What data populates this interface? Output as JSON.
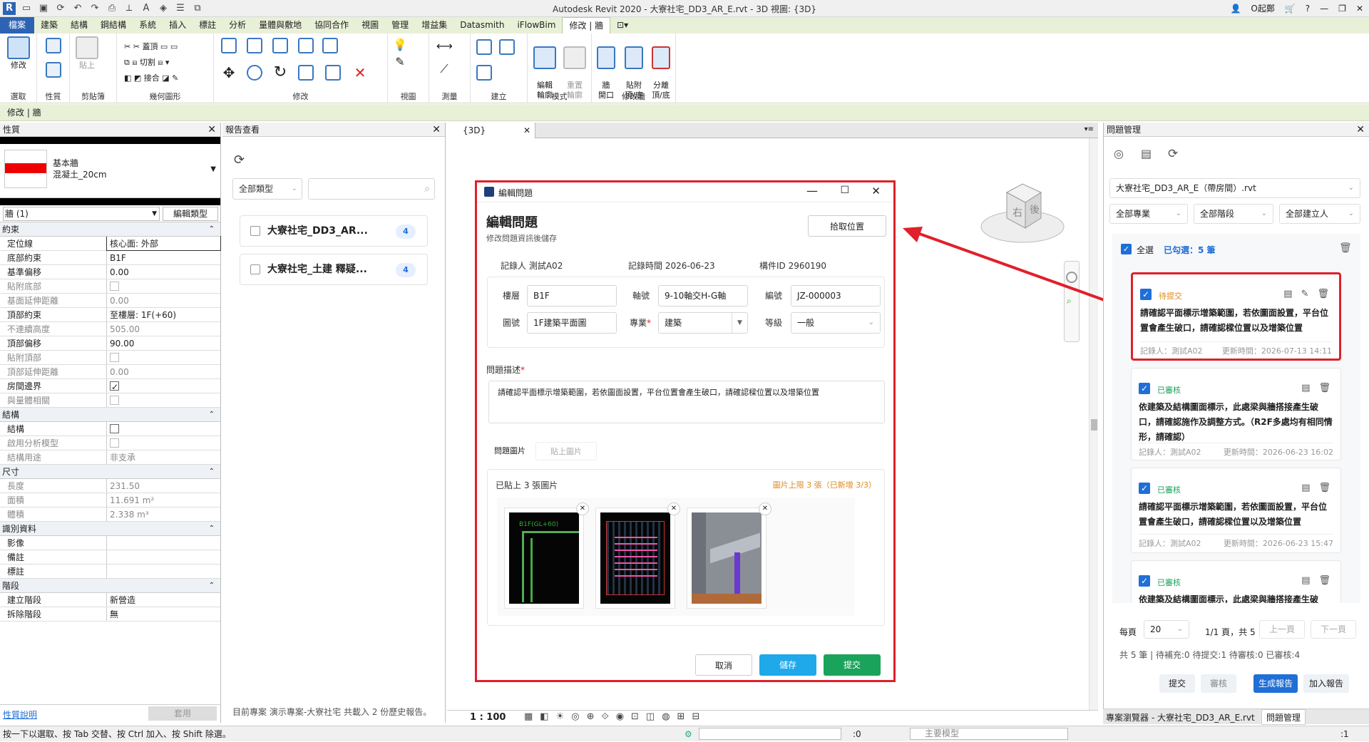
{
  "window": {
    "title": "Autodesk Revit 2020 - 大寮社宅_DD3_AR_E.rvt - 3D 視圖: {3D}",
    "user": "O起鄭"
  },
  "ribbon_tabs": [
    "檔案",
    "建築",
    "結構",
    "鋼結構",
    "系統",
    "插入",
    "標註",
    "分析",
    "量體與敷地",
    "協同合作",
    "視圖",
    "管理",
    "增益集",
    "Datasmith",
    "iFlowBim",
    "修改 | 牆"
  ],
  "ribbon_groups": {
    "select": "選取",
    "props": "性質",
    "clipboard": "剪貼簿",
    "geometry": "幾何圖形",
    "modify": "修改",
    "view": "視圖",
    "measure": "測量",
    "create": "建立",
    "mode": "模式",
    "modify_wall": "修改牆",
    "modify_btn": "修改",
    "paste_btn": "貼上",
    "geom_items": [
      "蓋頂",
      "切割",
      "接合"
    ],
    "edit_profile": "編輯\n輪廓",
    "reset_profile": "重置\n輪廓",
    "wall_opening": "牆\n開口",
    "attach": "貼附\n頂/底",
    "detach": "分離\n頂/底"
  },
  "context_bar": "修改 | 牆",
  "properties": {
    "header": "性質",
    "type_family": "基本牆",
    "type_name": "混凝土_20cm",
    "selector": "牆 (1)",
    "edit_type": "編輯類型",
    "sections": [
      {
        "title": "約束",
        "rows": [
          {
            "k": "定位線",
            "v": "核心面: 外部",
            "dis": false,
            "boxed": true
          },
          {
            "k": "底部約束",
            "v": "B1F",
            "dis": false
          },
          {
            "k": "基準偏移",
            "v": "0.00",
            "dis": false
          },
          {
            "k": "貼附底部",
            "v": "",
            "dis": true,
            "check": "off"
          },
          {
            "k": "基面延伸距離",
            "v": "0.00",
            "dis": true
          },
          {
            "k": "頂部約束",
            "v": "至樓層: 1F(+60)",
            "dis": false
          },
          {
            "k": "不連續高度",
            "v": "505.00",
            "dis": true
          },
          {
            "k": "頂部偏移",
            "v": "90.00",
            "dis": false
          },
          {
            "k": "貼附頂部",
            "v": "",
            "dis": true,
            "check": "off"
          },
          {
            "k": "頂部延伸距離",
            "v": "0.00",
            "dis": true
          },
          {
            "k": "房間邊界",
            "v": "",
            "dis": false,
            "check": "on"
          },
          {
            "k": "與量體相關",
            "v": "",
            "dis": true,
            "check": "off"
          }
        ]
      },
      {
        "title": "結構",
        "rows": [
          {
            "k": "結構",
            "v": "",
            "dis": false,
            "check": "off"
          },
          {
            "k": "啟用分析模型",
            "v": "",
            "dis": true,
            "check": "off"
          },
          {
            "k": "結構用途",
            "v": "非支承",
            "dis": true
          }
        ]
      },
      {
        "title": "尺寸",
        "rows": [
          {
            "k": "長度",
            "v": "231.50",
            "dis": true
          },
          {
            "k": "面積",
            "v": "11.691 m²",
            "dis": true
          },
          {
            "k": "體積",
            "v": "2.338 m³",
            "dis": true
          }
        ]
      },
      {
        "title": "識別資料",
        "rows": [
          {
            "k": "影像",
            "v": "",
            "dis": false
          },
          {
            "k": "備註",
            "v": "",
            "dis": false
          },
          {
            "k": "標註",
            "v": "",
            "dis": false
          }
        ]
      },
      {
        "title": "階段",
        "rows": [
          {
            "k": "建立階段",
            "v": "新營造",
            "dis": false
          },
          {
            "k": "拆除階段",
            "v": "無",
            "dis": false
          }
        ]
      }
    ],
    "help_link": "性質說明",
    "apply": "套用"
  },
  "report": {
    "header": "報告查看",
    "filter": "全部類型",
    "items": [
      {
        "name": "大寮社宅_DD3_AR...",
        "count": "4"
      },
      {
        "name": "大寮社宅_土建 釋疑...",
        "count": "4"
      }
    ],
    "footer": "目前專案 演示專案-大寮社宅 共載入 2 份歷史報告。"
  },
  "view": {
    "tab": "{3D}",
    "scale": "1 : 100",
    "viewcube_labels": [
      "右",
      "後"
    ]
  },
  "dialog": {
    "window_title": "編輯問題",
    "heading": "編輯問題",
    "subheading": "修改問題資訊後儲存",
    "pick_location": "拾取位置",
    "recorder_label": "記錄人",
    "recorder": "測試A02",
    "time_label": "記錄時間",
    "time": "2026-06-23",
    "id_label": "構件ID",
    "id": "2960190",
    "floor_label": "樓層",
    "floor": "B1F",
    "axis_label": "軸號",
    "axis": "9-10軸交H-G軸",
    "code_label": "編號",
    "code": "JZ-000003",
    "drawing_label": "圖號",
    "drawing": "1F建築平面圖",
    "discipline_label": "專業",
    "discipline": "建築",
    "level_label": "等級",
    "level": "一般",
    "desc_label": "問題描述",
    "desc": "請確認平面標示增築範圍，若依圖面設置，平台位置會產生破口，請確認樑位置以及增築位置",
    "img_tab": "問題圖片",
    "paste_tab": "貼上圖片",
    "uploaded": "已貼上 3 張圖片",
    "limit": "圖片上限 3 張（已新增 3/3）",
    "img1_caption": "B1F(GL+60)",
    "cancel": "取消",
    "save": "儲存",
    "submit": "提交"
  },
  "issues": {
    "header": "問題管理",
    "project": "大寮社宅_DD3_AR_E（帶房間）.rvt",
    "filters": [
      "全部專業",
      "全部階段",
      "全部建立人"
    ],
    "select_all": "全選",
    "selected": "已勾選：5 筆",
    "cards": [
      {
        "status": "待提交",
        "status_color": "#e08a1a",
        "text": "請確認平面標示增築範圍，若依圖面設置，平台位置會產生破口，請確認樑位置以及增築位置",
        "recorder": "記錄人：測試A02",
        "updated": "更新時間：2026-07-13 14:11"
      },
      {
        "status": "已審核",
        "status_color": "#1aa35a",
        "text": "依建築及結構圖面標示，此處梁與牆搭接產生破口，請確認施作及調整方式。（R2F多處均有相同情形，請確認）",
        "recorder": "記錄人：測試A02",
        "updated": "更新時間：2026-06-23 16:02"
      },
      {
        "status": "已審核",
        "status_color": "#1aa35a",
        "text": "請確認平面標示增築範圍，若依圖面設置，平台位置會產生破口，請確認樑位置以及增築位置",
        "recorder": "記錄人：測試A02",
        "updated": "更新時間：2026-06-23 15:47"
      },
      {
        "status": "已審核",
        "status_color": "#1aa35a",
        "text": "依建築及結構圖面標示，此處梁與牆搭接產生破口，",
        "recorder": "",
        "updated": ""
      }
    ],
    "per_page_label": "每頁",
    "per_page": "20",
    "page_info": "1/1 頁，共 5",
    "prev": "上一頁",
    "next": "下一頁",
    "summary": "共 5 筆 | 待補充:0 待提交:1 待審核:0 已審核:4",
    "btn_submit": "提交",
    "btn_review": "審核",
    "btn_generate": "生成報告",
    "btn_add": "加入報告",
    "tab_browser": "專案瀏覽器 - 大寮社宅_DD3_AR_E.rvt",
    "tab_issues": "問題管理"
  },
  "status": {
    "hint": "按一下以選取、按 Tab 交替、按 Ctrl 加入、按 Shift 除選。",
    "zero": ":0",
    "model": "主要模型",
    "filter_count": ":1"
  },
  "colors": {
    "accent": "#1f6fd6",
    "highlight": "#e0202a",
    "green": "#1aa35a",
    "cyan": "#1fa8ea"
  }
}
